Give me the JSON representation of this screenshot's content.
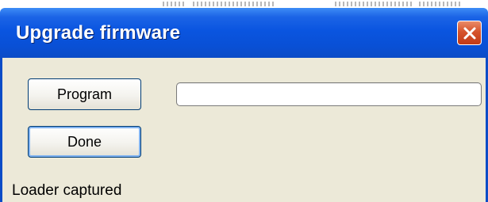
{
  "window": {
    "title": "Upgrade firmware",
    "close_icon": "close-icon"
  },
  "buttons": {
    "program_label": "Program",
    "done_label": "Done"
  },
  "progress": {
    "value": 0
  },
  "status": {
    "text": "Loader captured"
  },
  "colors": {
    "titlebar": "#0a55e0",
    "client_background": "#ece9d8",
    "close_button": "#d6532c"
  }
}
